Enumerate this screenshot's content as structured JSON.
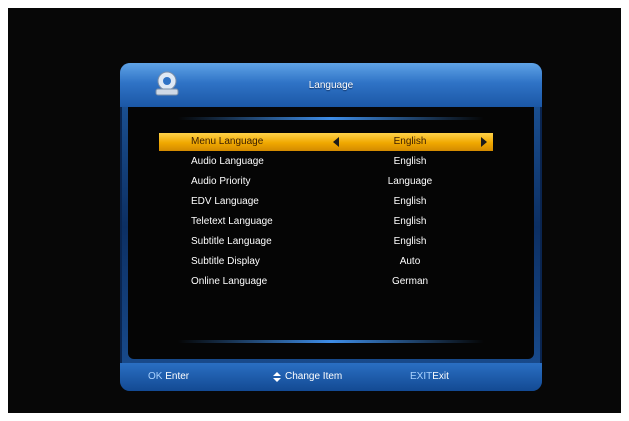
{
  "header": {
    "title": "Language"
  },
  "menu": [
    {
      "label": "Menu Language",
      "value": "English",
      "selected": true
    },
    {
      "label": "Audio Language",
      "value": "English"
    },
    {
      "label": "Audio Priority",
      "value": "Language"
    },
    {
      "label": "EDV Language",
      "value": "English"
    },
    {
      "label": "Teletext Language",
      "value": "English"
    },
    {
      "label": "Subtitle Language",
      "value": "English"
    },
    {
      "label": "Subtitle Display",
      "value": "Auto"
    },
    {
      "label": "Online Language",
      "value": "German"
    }
  ],
  "footer": {
    "ok_key": "OK",
    "ok_label": " Enter",
    "change_label": "Change Item",
    "exit_key": "EXIT",
    "exit_label": "Exit"
  },
  "colors": {
    "accent": "#2f73c6",
    "selection": "#f0a800",
    "background": "#070707"
  }
}
